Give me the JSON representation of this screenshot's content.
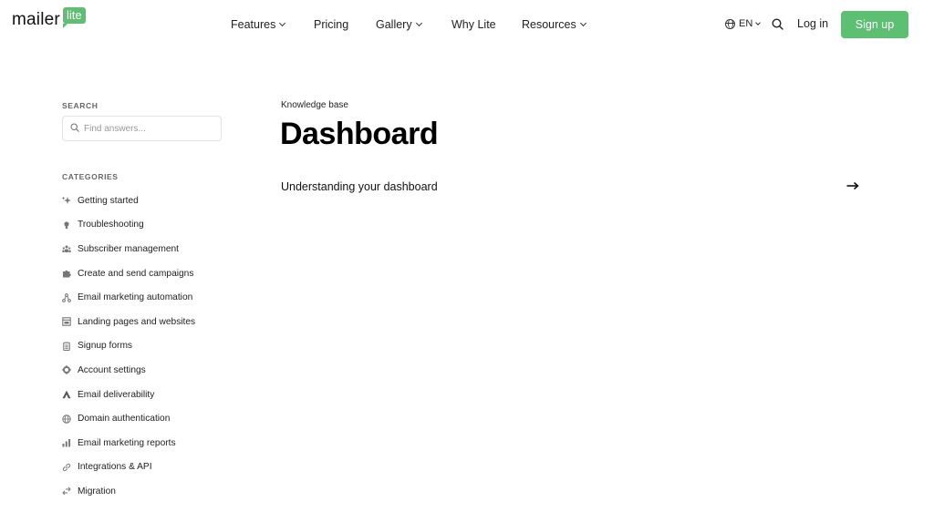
{
  "header": {
    "logo": {
      "word": "mailer",
      "badge": "lite"
    },
    "nav": [
      {
        "label": "Features",
        "dropdown": true
      },
      {
        "label": "Pricing",
        "dropdown": false
      },
      {
        "label": "Gallery",
        "dropdown": true
      },
      {
        "label": "Why Lite",
        "dropdown": false
      },
      {
        "label": "Resources",
        "dropdown": true
      }
    ],
    "language": "EN",
    "login_label": "Log in",
    "signup_label": "Sign up",
    "accent_color": "#5cbf72"
  },
  "sidebar": {
    "search_label": "SEARCH",
    "search_placeholder": "Find answers...",
    "search_value": "",
    "categories_label": "CATEGORIES",
    "categories": [
      {
        "label": "Getting started",
        "icon": "sparkle-icon"
      },
      {
        "label": "Troubleshooting",
        "icon": "lightbulb-icon"
      },
      {
        "label": "Subscriber management",
        "icon": "users-icon"
      },
      {
        "label": "Create and send campaigns",
        "icon": "puzzle-icon"
      },
      {
        "label": "Email marketing automation",
        "icon": "workflow-icon"
      },
      {
        "label": "Landing pages and websites",
        "icon": "layout-icon"
      },
      {
        "label": "Signup forms",
        "icon": "clipboard-icon"
      },
      {
        "label": "Account settings",
        "icon": "gear-icon"
      },
      {
        "label": "Email deliverability",
        "icon": "triangle-icon"
      },
      {
        "label": "Domain authentication",
        "icon": "globe-icon"
      },
      {
        "label": "Email marketing reports",
        "icon": "bar-chart-icon"
      },
      {
        "label": "Integrations & API",
        "icon": "link-icon"
      },
      {
        "label": "Migration",
        "icon": "swap-arrows-icon"
      }
    ]
  },
  "main": {
    "breadcrumb": "Knowledge base",
    "title": "Dashboard",
    "articles": [
      {
        "title": "Understanding your dashboard",
        "icon": "arrow-right-icon"
      }
    ]
  }
}
